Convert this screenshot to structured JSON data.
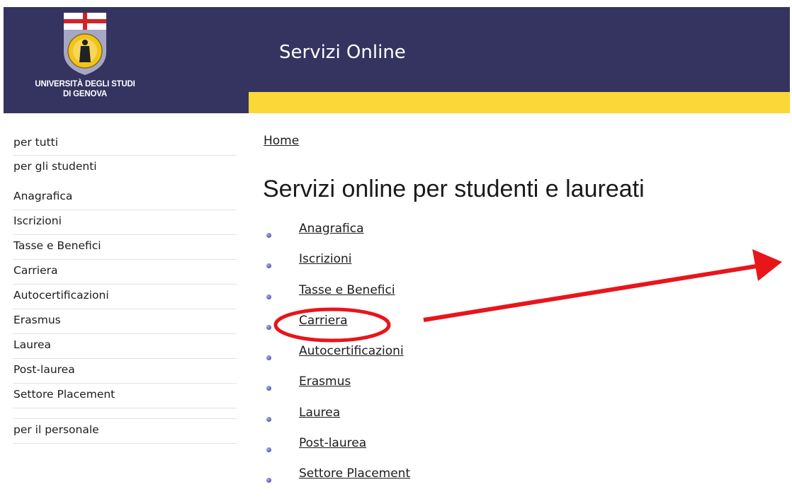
{
  "header": {
    "logo_name_line1": "UNIVERSITÀ DEGLI STUDI",
    "logo_name_line2": "DI GENOVA",
    "title": "Servizi Online"
  },
  "sidebar": {
    "items": [
      {
        "label": "per tutti"
      },
      {
        "label": "per gli studenti"
      },
      {
        "label": "Anagrafica"
      },
      {
        "label": "Iscrizioni"
      },
      {
        "label": "Tasse e Benefici"
      },
      {
        "label": "Carriera"
      },
      {
        "label": "Autocertificazioni"
      },
      {
        "label": "Erasmus"
      },
      {
        "label": "Laurea"
      },
      {
        "label": "Post-laurea"
      },
      {
        "label": "Settore Placement"
      },
      {
        "label": "per il personale"
      }
    ]
  },
  "main": {
    "breadcrumb": "Home",
    "title": "Servizi online per studenti e laureati",
    "links": [
      {
        "label": "Anagrafica"
      },
      {
        "label": "Iscrizioni"
      },
      {
        "label": "Tasse e Benefici"
      },
      {
        "label": "Carriera"
      },
      {
        "label": "Autocertificazioni"
      },
      {
        "label": "Erasmus"
      },
      {
        "label": "Laurea"
      },
      {
        "label": "Post-laurea"
      },
      {
        "label": "Settore Placement"
      }
    ]
  },
  "colors": {
    "header_bg": "#353460",
    "accent_yellow": "#fcd738",
    "annotation_red": "#e8151b"
  }
}
